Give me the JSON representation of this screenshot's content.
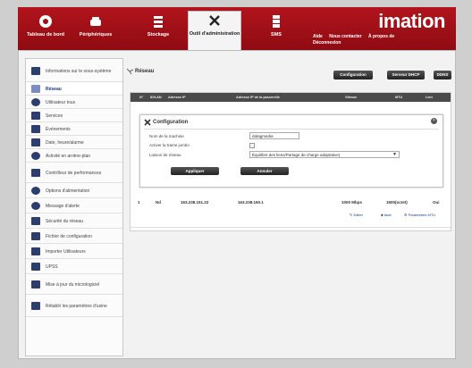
{
  "topnav": {
    "items": [
      {
        "label": "Tableau de bord",
        "icon": "dashboard-icon"
      },
      {
        "label": "Périphériques",
        "icon": "car-icon"
      },
      {
        "label": "Stockage",
        "icon": "storage-icon"
      },
      {
        "label": "Outil d'administration",
        "icon": "admin-tools-icon"
      },
      {
        "label": "SMS",
        "icon": "server-icon"
      }
    ],
    "logo": "imation",
    "links": [
      "Aide",
      "Nous contacter",
      "À propos de",
      "Déconnexion"
    ]
  },
  "sidebar": {
    "items": [
      {
        "label": "Informations sur le sous-système",
        "icon": "system-info-icon"
      },
      {
        "label": "Réseau",
        "icon": "network-icon"
      },
      {
        "label": "Utilisateur tous",
        "icon": "user-icon"
      },
      {
        "label": "Services",
        "icon": "services-icon"
      },
      {
        "label": "Événements",
        "icon": "events-icon"
      },
      {
        "label": "Date, heure/alarme",
        "icon": "date-time-icon"
      },
      {
        "label": "Activité en arrière-plan",
        "icon": "background-activity-icon"
      },
      {
        "label": "Contrôleur de performances",
        "icon": "performance-icon"
      },
      {
        "label": "Options d'alimentation",
        "icon": "power-icon"
      },
      {
        "label": "Message d'alerte",
        "icon": "alert-icon"
      },
      {
        "label": "Sécurité du réseau",
        "icon": "security-icon"
      },
      {
        "label": "Fichier de configuration",
        "icon": "config-file-icon"
      },
      {
        "label": "Importer Utilisateurs",
        "icon": "import-users-icon"
      },
      {
        "label": "UPSS",
        "icon": "ups-icon"
      },
      {
        "label": "Mise à jour du micrologiciel",
        "icon": "firmware-icon"
      },
      {
        "label": "Rétablir les paramètres d'usine",
        "icon": "factory-reset-icon"
      }
    ]
  },
  "page": {
    "title": "Réseau",
    "buttons": [
      "Configuration",
      "Serveur DHCP",
      "DDNS"
    ]
  },
  "grid": {
    "headers": [
      "N°",
      "ID/LAN",
      "Adresse IP",
      "Adresse IP de la passerelle",
      "Vitesse",
      "MTU",
      "Lien"
    ]
  },
  "config": {
    "title": "Configuration",
    "fields": [
      {
        "label": "Nom de la machine",
        "value": "datagmedia"
      },
      {
        "label": "Activer la trame jumbo"
      },
      {
        "label": "Liaison de réseau",
        "value": "Équilibre des liens/Partage de charge adaptative)"
      }
    ],
    "buttons": [
      "Appliquer",
      "Annuler"
    ]
  },
  "row": {
    "num": "1",
    "lan": "Nd",
    "ip": "163.238.151.22",
    "gateway": "163.238.160.1",
    "speed": "1000 Mbps",
    "mtu": "1500(octet)",
    "link": "Oui",
    "actions": [
      "Editer",
      "Aide",
      "Paramètres MTU"
    ]
  }
}
